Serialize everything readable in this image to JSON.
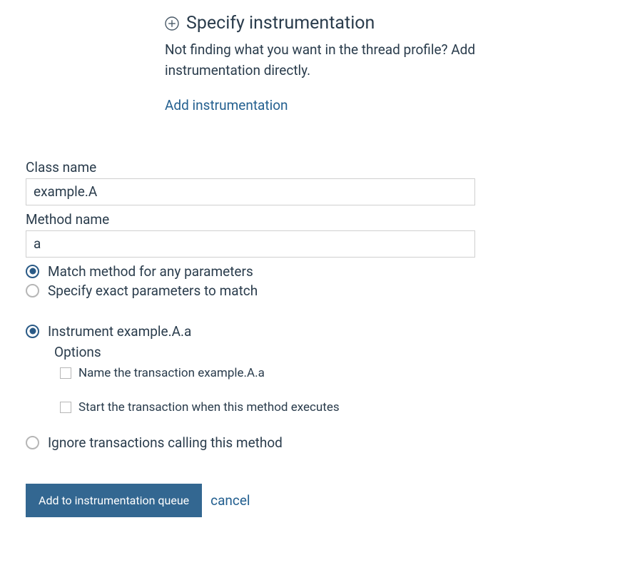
{
  "header": {
    "title": "Specify instrumentation",
    "description": "Not finding what you want in the thread profile? Add instrumentation directly.",
    "link_label": "Add instrumentation"
  },
  "form": {
    "class_name_label": "Class name",
    "class_name_value": "example.A",
    "method_name_label": "Method name",
    "method_name_value": "a",
    "match": {
      "any_label": "Match method for any parameters",
      "exact_label": "Specify exact parameters to match",
      "selected": "any"
    },
    "action": {
      "instrument_label": "Instrument example.A.a",
      "ignore_label": "Ignore transactions calling this method",
      "selected": "instrument"
    },
    "options": {
      "heading": "Options",
      "name_transaction_label": "Name the transaction example.A.a",
      "start_transaction_label": "Start the transaction when this method executes"
    },
    "submit_label": "Add to instrumentation queue",
    "cancel_label": "cancel"
  }
}
